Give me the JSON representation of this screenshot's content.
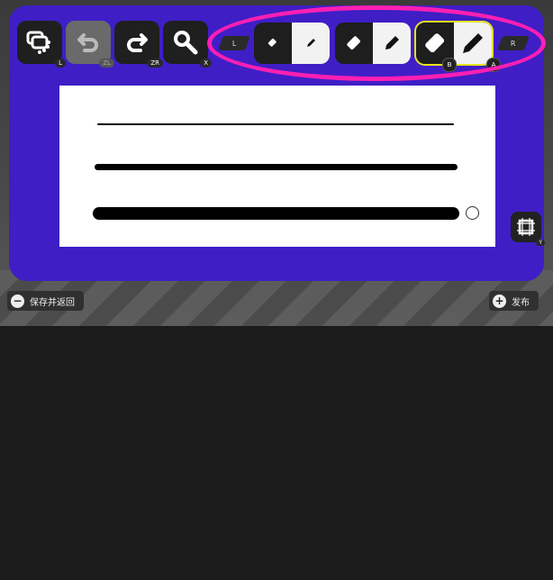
{
  "toolbar": {
    "copy_hint": "L",
    "undo_hint": "ZL",
    "redo_hint": "ZR",
    "zoom_hint": "X",
    "shoulder_left": "L",
    "shoulder_right": "R",
    "group_small_badge_eraser": "",
    "selected_badge_eraser": "B",
    "selected_badge_pen": "A"
  },
  "canvas": {
    "frame_hint": "Y"
  },
  "footer": {
    "save_label": "保存并返回",
    "save_icon": "−",
    "publish_label": "发布",
    "publish_icon": "+"
  },
  "colors": {
    "panel": "#3f1ec6",
    "highlight": "#ff1fb2",
    "selection": "#e5e31c"
  },
  "icons": [
    "copy-icon",
    "undo-icon",
    "redo-icon",
    "zoom-icon",
    "eraser-icon",
    "pen-icon",
    "frame-icon"
  ]
}
